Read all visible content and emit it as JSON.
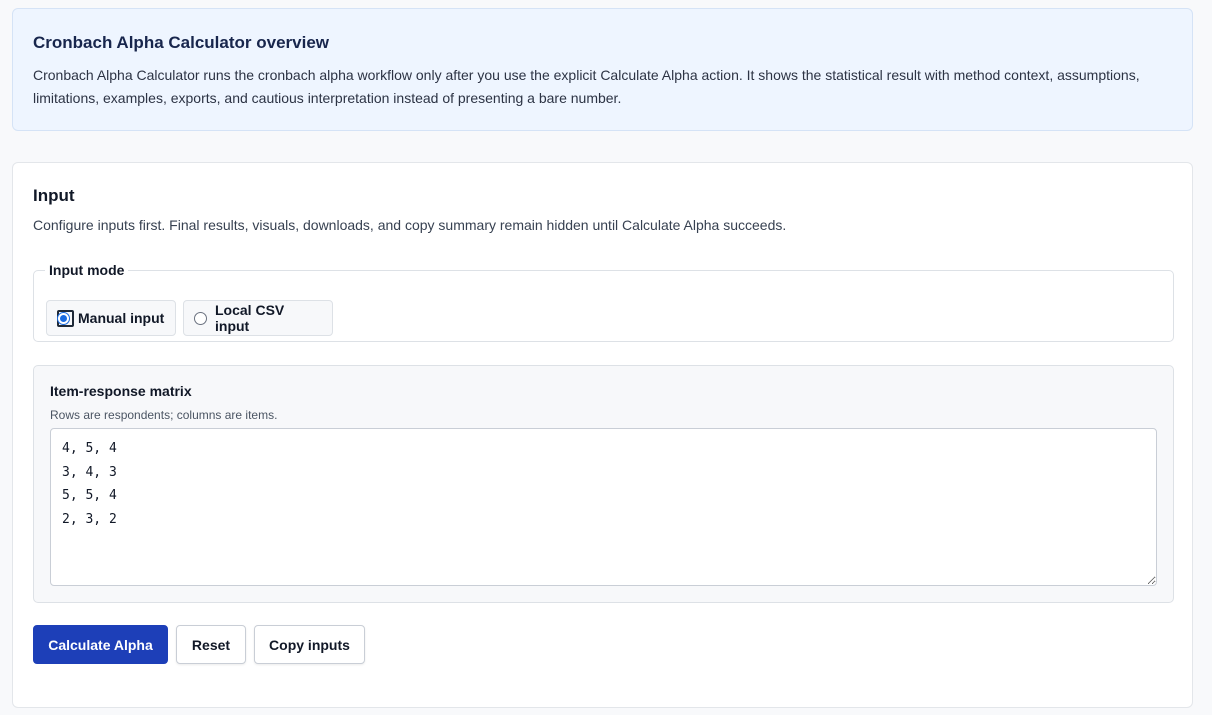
{
  "overview": {
    "title": "Cronbach Alpha Calculator overview",
    "text": "Cronbach Alpha Calculator runs the cronbach alpha workflow only after you use the explicit Calculate Alpha action. It shows the statistical result with method context, assumptions, limitations, examples, exports, and cautious interpretation instead of presenting a bare number."
  },
  "input": {
    "title": "Input",
    "description": "Configure inputs first. Final results, visuals, downloads, and copy summary remain hidden until Calculate Alpha succeeds.",
    "mode": {
      "legend": "Input mode",
      "options": [
        {
          "label": "Manual input",
          "selected": true
        },
        {
          "label": "Local CSV input",
          "selected": false
        }
      ]
    },
    "matrix": {
      "label": "Item-response matrix",
      "hint": "Rows are respondents; columns are items.",
      "value": "4, 5, 4\n3, 4, 3\n5, 5, 4\n2, 3, 2"
    },
    "actions": {
      "calculate": "Calculate Alpha",
      "reset": "Reset",
      "copy": "Copy inputs"
    }
  },
  "colors": {
    "primary": "#1d3fb8",
    "radio_accent": "#1a6be0",
    "overview_bg": "#eef5ff"
  }
}
